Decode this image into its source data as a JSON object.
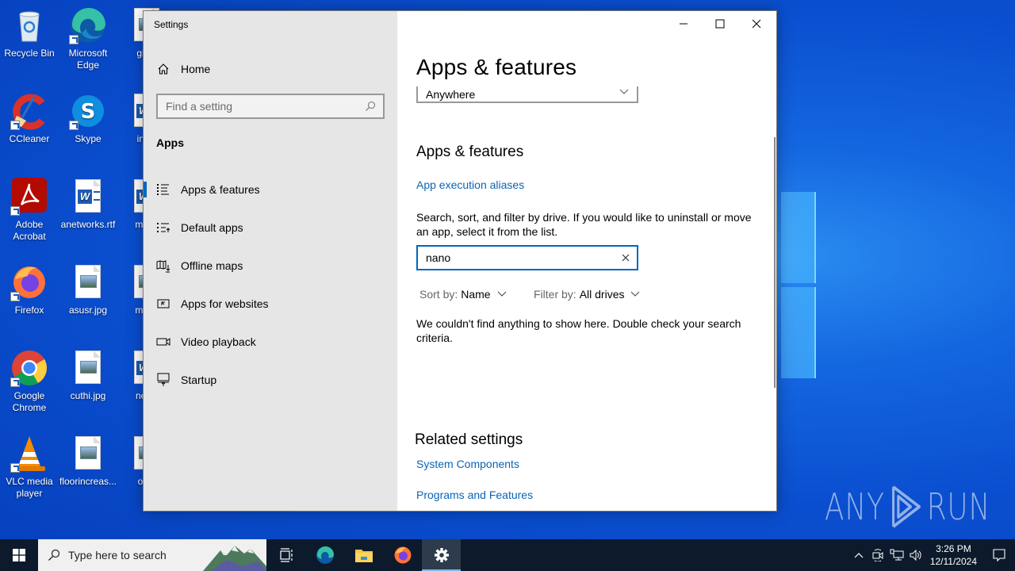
{
  "desktop": {
    "icons": [
      {
        "label": "Recycle Bin",
        "icon": "recycle-bin-icon"
      },
      {
        "label": "Microsoft Edge",
        "icon": "edge-icon"
      },
      {
        "label": "giftsf",
        "icon": "image-file-icon"
      },
      {
        "label": "CCleaner",
        "icon": "ccleaner-icon"
      },
      {
        "label": "Skype",
        "icon": "skype-icon"
      },
      {
        "label": "initia",
        "icon": "word-doc-icon"
      },
      {
        "label": "Adobe Acrobat",
        "icon": "acrobat-icon"
      },
      {
        "label": "anetworks.rtf",
        "icon": "word-doc-icon"
      },
      {
        "label": "madc",
        "icon": "word-doc-icon"
      },
      {
        "label": "Firefox",
        "icon": "firefox-icon"
      },
      {
        "label": "asusr.jpg",
        "icon": "image-file-icon"
      },
      {
        "label": "many",
        "icon": "image-file-icon"
      },
      {
        "label": "Google Chrome",
        "icon": "chrome-icon"
      },
      {
        "label": "cuthi.jpg",
        "icon": "image-file-icon"
      },
      {
        "label": "news",
        "icon": "word-doc-icon"
      },
      {
        "label": "VLC media player",
        "icon": "vlc-icon"
      },
      {
        "label": "floorincreas...",
        "icon": "image-file-icon"
      },
      {
        "label": "octo",
        "icon": "image-file-icon"
      }
    ],
    "watermark": {
      "left": "ANY",
      "right": "RUN"
    }
  },
  "settings": {
    "window_title": "Settings",
    "sidebar": {
      "home_label": "Home",
      "search_placeholder": "Find a setting",
      "section_heading": "Apps",
      "items": [
        {
          "label": "Apps & features",
          "icon": "apps-features-icon",
          "selected": true
        },
        {
          "label": "Default apps",
          "icon": "default-apps-icon",
          "selected": false
        },
        {
          "label": "Offline maps",
          "icon": "offline-maps-icon",
          "selected": false
        },
        {
          "label": "Apps for websites",
          "icon": "apps-websites-icon",
          "selected": false
        },
        {
          "label": "Video playback",
          "icon": "video-playback-icon",
          "selected": false
        },
        {
          "label": "Startup",
          "icon": "startup-icon",
          "selected": false
        }
      ]
    },
    "content": {
      "page_title": "Apps & features",
      "install_source_value": "Anywhere",
      "section_title": "Apps & features",
      "aliases_link": "App execution aliases",
      "description": "Search, sort, and filter by drive. If you would like to uninstall or move an app, select it from the list.",
      "app_search_value": "nano",
      "sort": {
        "key": "Sort by:",
        "value": "Name"
      },
      "filter": {
        "key": "Filter by:",
        "value": "All drives"
      },
      "empty_message": "We couldn't find anything to show here. Double check your search criteria.",
      "related_title": "Related settings",
      "related_links": [
        "System Components",
        "Programs and Features"
      ]
    },
    "accent_color": "#0067c0",
    "link_color": "#0a64b4"
  },
  "taskbar": {
    "search_placeholder": "Type here to search",
    "pinned": [
      "Task View",
      "Microsoft Edge",
      "File Explorer",
      "Firefox",
      "Settings"
    ],
    "active": "Settings",
    "clock": {
      "time": "3:26 PM",
      "date": "12/11/2024"
    }
  }
}
